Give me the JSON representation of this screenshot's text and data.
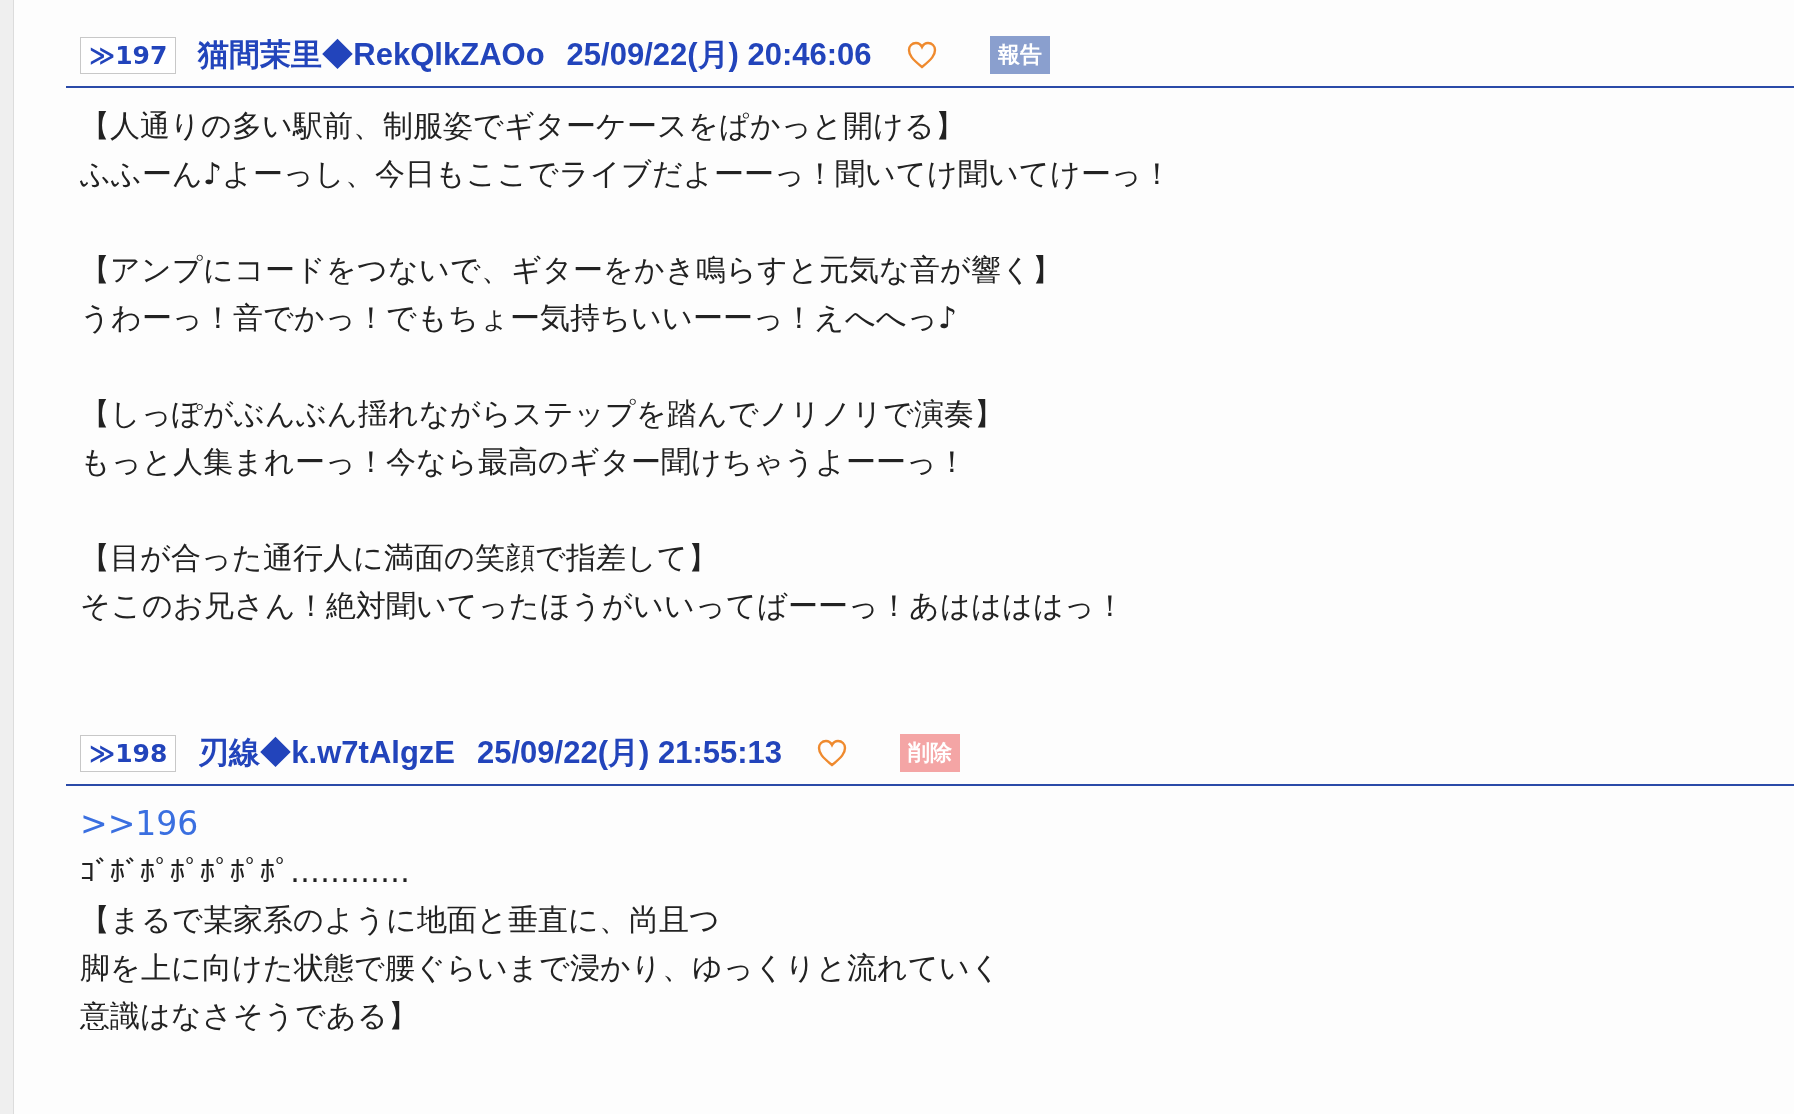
{
  "posts": [
    {
      "number": "≫197",
      "name": "猫間茉里◆RekQlkZAOo",
      "date": "25/09/22(月) 20:46:06",
      "action": {
        "kind": "report",
        "label": "報告"
      },
      "paragraphs": [
        [
          {
            "kind": "text",
            "text": "【人通りの多い駅前、制服姿でギターケースをぱかっと開ける】"
          },
          {
            "kind": "text",
            "text": "ふふーん♪よーっし、今日もここでライブだよーーっ！聞いてけ聞いてけーっ！"
          }
        ],
        [
          {
            "kind": "text",
            "text": "【アンプにコードをつないで、ギターをかき鳴らすと元気な音が響く】"
          },
          {
            "kind": "text",
            "text": "うわーっ！音でかっ！でもちょー気持ちいいーーっ！えへへっ♪"
          }
        ],
        [
          {
            "kind": "text",
            "text": "【しっぽがぶんぶん揺れながらステップを踏んでノリノリで演奏】"
          },
          {
            "kind": "text",
            "text": "もっと人集まれーっ！今なら最高のギター聞けちゃうよーーっ！"
          }
        ],
        [
          {
            "kind": "text",
            "text": "【目が合った通行人に満面の笑顔で指差して】"
          },
          {
            "kind": "text",
            "text": "そこのお兄さん！絶対聞いてったほうがいいってばーーっ！あははははっ！"
          }
        ]
      ]
    },
    {
      "number": "≫198",
      "name": "刃線◆k.w7tAlgzE",
      "date": "25/09/22(月) 21:55:13",
      "action": {
        "kind": "delete",
        "label": "削除"
      },
      "paragraphs": [
        [
          {
            "kind": "anchor",
            "text": ">>196"
          },
          {
            "kind": "text",
            "text": "ｺﾞﾎﾞﾎﾟﾎﾟﾎﾟﾎﾟﾎﾟ…………"
          },
          {
            "kind": "text",
            "text": "【まるで某家系のように地面と垂直に、尚且つ"
          },
          {
            "kind": "text",
            "text": "脚を上に向けた状態で腰ぐらいまで浸かり、ゆっくりと流れていく"
          },
          {
            "kind": "text",
            "text": "意識はなさそうである】"
          }
        ]
      ]
    }
  ]
}
